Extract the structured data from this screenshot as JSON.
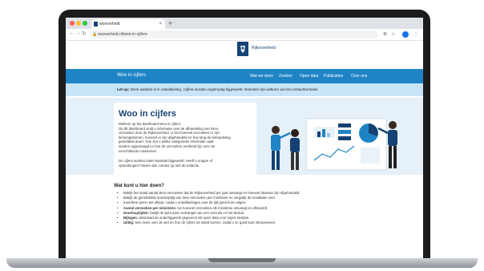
{
  "browser": {
    "tab_title": "wooverheid",
    "tab_close": "×",
    "new_tab": "+",
    "url": "wooverheid.nl/woo-in-cijfers",
    "back": "←",
    "forward": "→",
    "reload": "↻",
    "lock": "🔒"
  },
  "site": {
    "logo_text": "Rijksoverheid",
    "nav_title": "Woo in cijfers",
    "nav_links": [
      "Wat we doen",
      "Zoeken",
      "Open data",
      "Publicaties",
      "Over ons"
    ]
  },
  "notice": {
    "prefix": "Let op:",
    "text": "Deze website is in ontwikkeling. Cijfers worden regelmatig bijgewerkt. Reacties zijn welkom via het contactformulier."
  },
  "hero": {
    "title": "Woo in cijfers",
    "p1": [
      "Welkom op het dashboard Woo in cijfers.",
      "Op dit dashboard vindt u informatie over de afhandeling van Woo-",
      "verzoeken door de Rijksoverheid. U ziet hoeveel verzoeken er zijn",
      "binnengekomen, hoeveel er zijn afgehandeld en hoe lang de behandeling",
      "gemiddeld duurt. Ook ziet u welke categorieën informatie vaak",
      "worden opgevraagd en hoe de verzoeken verdeeld zijn over de",
      "verschillende ministeries."
    ],
    "p2": [
      "De cijfers worden ieder kwartaal bijgewerkt. Heeft u vragen of",
      "opmerkingen? Neem dan contact op met de redactie."
    ]
  },
  "content": {
    "section_title": "Wat kunt u hier doen?",
    "bullets": [
      {
        "bold": "",
        "text": "Bekijk het totaal aantal Woo-verzoeken dat de Rijksoverheid per jaar ontvangt en hoeveel daarvan zijn afgehandeld."
      },
      {
        "bold": "",
        "text": "Bekijk de gemiddelde doorlooptijd van Woo-verzoeken per ministerie en vergelijk de resultaten over"
      },
      {
        "bold": "",
        "text": "meerdere jaren met elkaar, zodat u ontwikkelingen over de tijd goed kunt volgen."
      },
      {
        "bold": "Aantal verzoeken per ministerie:",
        "text": "zie hoeveel verzoeken elk ministerie ontvangt en afhandelt."
      },
      {
        "bold": "Doorlooptijden:",
        "text": "bekijk de tijd tussen ontvangst van een verzoek en het besluit."
      },
      {
        "bold": "Bijlagen:",
        "text": "download de onderliggende gegevens als open data voor eigen analyse."
      },
      {
        "bold": "Uitleg:",
        "text": "lees meer over de wet en hoe de cijfers tot stand komen, zodat u ze goed kunt interpreteren."
      }
    ]
  },
  "colors": {
    "navbar": "#1f84c5",
    "notice": "#c8e4f7",
    "hero_bg": "#e6f0f8",
    "brand": "#154273"
  }
}
